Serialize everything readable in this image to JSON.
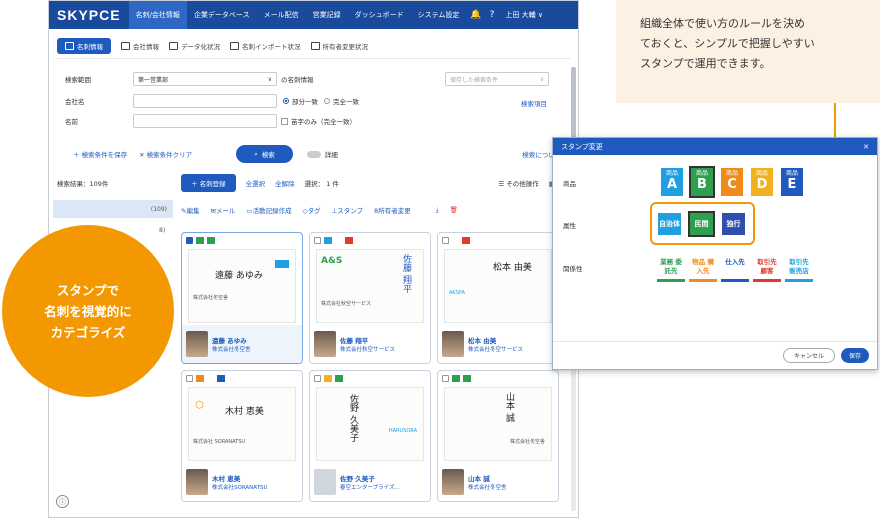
{
  "header": {
    "logo": "SKYPCE",
    "nav": [
      "名刺/会社情報",
      "企業データベース",
      "メール配信",
      "営業記録",
      "ダッシュボード",
      "システム設定"
    ],
    "user": "上田 大輔 ∨"
  },
  "subtabs": [
    "名刺情報",
    "会社情報",
    "データ化状況",
    "名刺インポート状況",
    "所有者変更状況"
  ],
  "search": {
    "scope_label": "検索範囲",
    "scope_value": "第一営業部",
    "scope_suffix": "の名刺情報",
    "saved_placeholder": "保存した検索条件",
    "company_label": "会社名",
    "partial": "部分一致",
    "exact": "完全一致",
    "fields_link": "検索項目",
    "name_label": "名前",
    "surname_only": "苗字のみ（完全一致）",
    "save_cond": "＋ 検索条件を保存",
    "clear_cond": "✕ 検索条件クリア",
    "search_btn": "検索",
    "detail": "詳細",
    "about": "検索について"
  },
  "results": {
    "count": "検索結果：109件",
    "register": "＋ 名刺登録",
    "select_all": "全選択",
    "deselect": "全解除",
    "selected": "選択： 1 件",
    "other_ops": "その他操作",
    "display": "表示",
    "panel_count": "(109)",
    "panel_count2": "8)"
  },
  "toolbar": [
    "編集",
    "メール",
    "活動記録作成",
    "タグ",
    "スタンプ",
    "所有者変更"
  ],
  "cards": [
    {
      "name": "遠藤 あゆみ",
      "company": "株式会社冬空舎",
      "bc_name": "遠藤 あゆみ",
      "bc_co": "株式会社冬空舎"
    },
    {
      "name": "佐藤 翔平",
      "company": "株式会社秋空サービス",
      "bc_name": "佐藤 翔平",
      "bc_co": "株式会社秋空サービス"
    },
    {
      "name": "松本 由美",
      "company": "株式会社冬空サービス",
      "bc_name": "松本 由美",
      "bc_co": "AKSPA"
    },
    {
      "name": "木村 恵美",
      "company": "株式会社SORANATSU",
      "bc_name": "木村 恵美",
      "bc_co": "株式会社 SORANATSU"
    },
    {
      "name": "佐野 久美子",
      "company": "春空エンタープライズ...",
      "bc_name": "佐野 久美子",
      "bc_co": "HARUSORA"
    },
    {
      "name": "山本 誠",
      "company": "株式会社冬空舎",
      "bc_name": "山本 誠",
      "bc_co": "株式会社冬空舎"
    }
  ],
  "callout": {
    "text": [
      "組織全体で使い方のルールを決め",
      "ておくと、シンプルで把握しやすい",
      "スタンプで運用できます。"
    ]
  },
  "circle": {
    "lines": [
      "スタンプで",
      "名刺を視覚的に",
      "カテゴライズ"
    ]
  },
  "dialog": {
    "title": "スタンプ変更",
    "close": "✕",
    "product_label": "商品",
    "attr_label": "属性",
    "rel_label": "関係性",
    "products": [
      {
        "top": "商品",
        "letter": "A",
        "color": "#1f9fe0"
      },
      {
        "top": "商品",
        "letter": "B",
        "color": "#2e9e4f"
      },
      {
        "top": "商品",
        "letter": "C",
        "color": "#f08a1a"
      },
      {
        "top": "商品",
        "letter": "D",
        "color": "#f2b01e"
      },
      {
        "top": "商品",
        "letter": "E",
        "color": "#1f5bbf"
      }
    ],
    "attrs": [
      {
        "label": "自治体",
        "color": "#1f9fe0"
      },
      {
        "label": "民間",
        "color": "#2e9e4f"
      },
      {
        "label": "独行",
        "color": "#2f4fb0"
      }
    ],
    "relations": [
      {
        "label": "業務 委託先",
        "color": "#2e9e4f"
      },
      {
        "label": "物品 購入先",
        "color": "#f08a1a"
      },
      {
        "label": "仕入先",
        "color": "#1f5bbf"
      },
      {
        "label": "取引先 顧客",
        "color": "#e23a2a"
      },
      {
        "label": "取引先 販売店",
        "color": "#1f9fe0"
      }
    ],
    "cancel": "キャンセル",
    "save": "保存"
  },
  "colors": {
    "brand": "#1a4a9c",
    "accent": "#1f5bbf",
    "highlight": "#f39800"
  }
}
